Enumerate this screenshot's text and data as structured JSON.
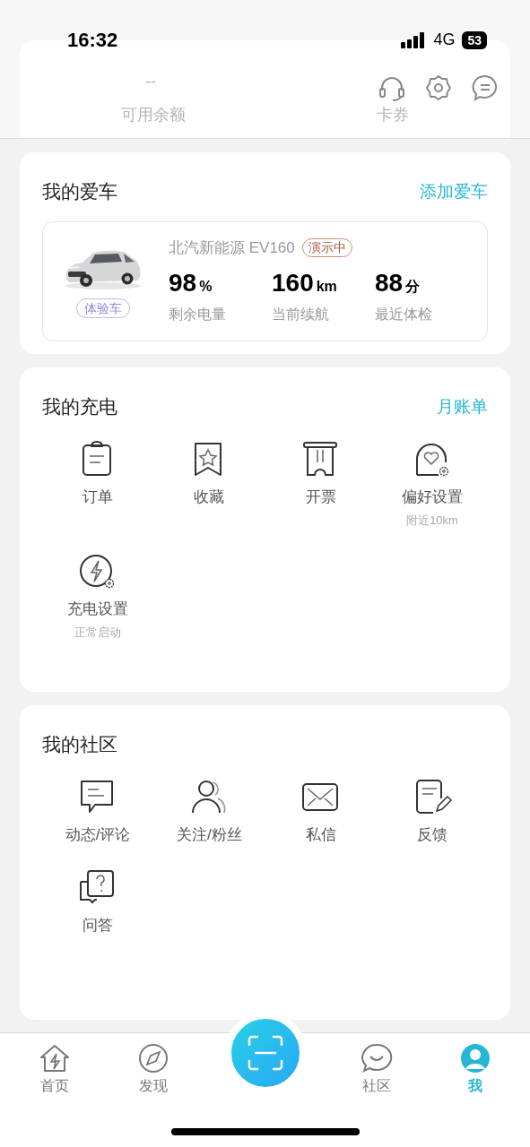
{
  "status_bar": {
    "time": "16:32",
    "network": "4G",
    "battery": "53"
  },
  "header": {
    "balance_value": "--",
    "balance_label": "可用余额",
    "coupon_label": "卡券"
  },
  "my_car": {
    "title": "我的爱车",
    "action": "添加爱车",
    "car": {
      "name": "北汽新能源 EV160",
      "status_badge": "演示中",
      "tag": "体验车",
      "stats": [
        {
          "value": "98",
          "unit": "%",
          "label": "剩余电量"
        },
        {
          "value": "160",
          "unit": "km",
          "label": "当前续航"
        },
        {
          "value": "88",
          "unit": "分",
          "label": "最近体检"
        }
      ]
    }
  },
  "my_charging": {
    "title": "我的充电",
    "action": "月账单",
    "items": [
      {
        "label": "订单"
      },
      {
        "label": "收藏"
      },
      {
        "label": "开票"
      },
      {
        "label": "偏好设置",
        "sub": "附近10km"
      },
      {
        "label": "充电设置",
        "sub": "正常启动"
      }
    ]
  },
  "my_community": {
    "title": "我的社区",
    "items": [
      {
        "label": "动态/评论"
      },
      {
        "label": "关注/粉丝"
      },
      {
        "label": "私信"
      },
      {
        "label": "反馈"
      },
      {
        "label": "问答"
      }
    ]
  },
  "tab_bar": {
    "tabs": [
      {
        "label": "首页",
        "selected": false
      },
      {
        "label": "发现",
        "selected": false
      },
      {
        "label": "社区",
        "selected": false
      },
      {
        "label": "我",
        "selected": true
      }
    ]
  }
}
